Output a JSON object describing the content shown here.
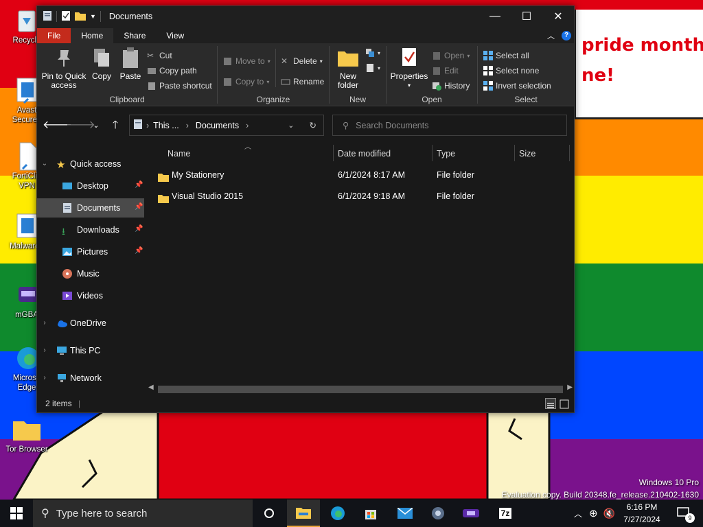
{
  "desktop": {
    "bubble_text": "pride month\nne!",
    "icons": [
      {
        "label": "Recycle",
        "icon": "recycle-bin-icon"
      },
      {
        "label": "Avast",
        "label2": "SecureL",
        "icon": "avast-icon"
      },
      {
        "label": "FortiClie",
        "label2": "VPN",
        "icon": "forticlient-icon"
      },
      {
        "label": "Malwareb",
        "icon": "malwarebytes-icon"
      },
      {
        "label": "mGBA",
        "icon": "mgba-icon"
      },
      {
        "label": "Microso",
        "label2": "Edge",
        "icon": "edge-icon"
      },
      {
        "label": "Tor Browser",
        "icon": "folder-icon"
      }
    ],
    "watermark_line1": "Windows 10 Pro",
    "watermark_line2": "Evaluation copy. Build 20348.fe_release.210402-1630"
  },
  "window": {
    "title": "Documents",
    "minimize": "—",
    "maximize": "☐",
    "close": "✕"
  },
  "ribbon": {
    "tabs": [
      "File",
      "Home",
      "Share",
      "View"
    ],
    "active_tab": "Home",
    "clipboard": {
      "label": "Clipboard",
      "pin": "Pin to Quick\naccess",
      "copy": "Copy",
      "paste": "Paste",
      "cut": "Cut",
      "copy_path": "Copy path",
      "paste_shortcut": "Paste shortcut"
    },
    "organize": {
      "label": "Organize",
      "move_to": "Move to",
      "copy_to": "Copy to",
      "delete": "Delete",
      "rename": "Rename"
    },
    "new": {
      "label": "New",
      "new_folder": "New\nfolder"
    },
    "open": {
      "label": "Open",
      "properties": "Properties",
      "open": "Open",
      "edit": "Edit",
      "history": "History"
    },
    "select": {
      "label": "Select",
      "select_all": "Select all",
      "select_none": "Select none",
      "invert": "Invert selection"
    }
  },
  "address": {
    "crumbs": [
      "This ...",
      "Documents"
    ],
    "search_placeholder": "Search Documents"
  },
  "sidebar": {
    "quick_access": "Quick access",
    "items": [
      {
        "label": "Desktop",
        "icon": "desktop-icon",
        "pinned": true
      },
      {
        "label": "Documents",
        "icon": "documents-icon",
        "pinned": true,
        "selected": true
      },
      {
        "label": "Downloads",
        "icon": "downloads-icon",
        "pinned": true
      },
      {
        "label": "Pictures",
        "icon": "pictures-icon",
        "pinned": true
      },
      {
        "label": "Music",
        "icon": "music-icon",
        "pinned": false
      },
      {
        "label": "Videos",
        "icon": "videos-icon",
        "pinned": false
      }
    ],
    "onedrive": "OneDrive",
    "this_pc": "This PC",
    "network": "Network"
  },
  "files": {
    "columns": [
      "Name",
      "Date modified",
      "Type",
      "Size"
    ],
    "rows": [
      {
        "name": "My Stationery",
        "date": "6/1/2024 8:17 AM",
        "type": "File folder",
        "size": ""
      },
      {
        "name": "Visual Studio 2015",
        "date": "6/1/2024 9:18 AM",
        "type": "File folder",
        "size": ""
      }
    ]
  },
  "status": {
    "items_count": "2 items"
  },
  "taskbar": {
    "search_placeholder": "Type here to search",
    "time": "6:16 PM",
    "date": "7/27/2024",
    "notification_count": "9"
  },
  "colors": {
    "file_tab": "#c42b1c",
    "folder": "#f6c94c",
    "accent_blue": "#1a73e8"
  }
}
